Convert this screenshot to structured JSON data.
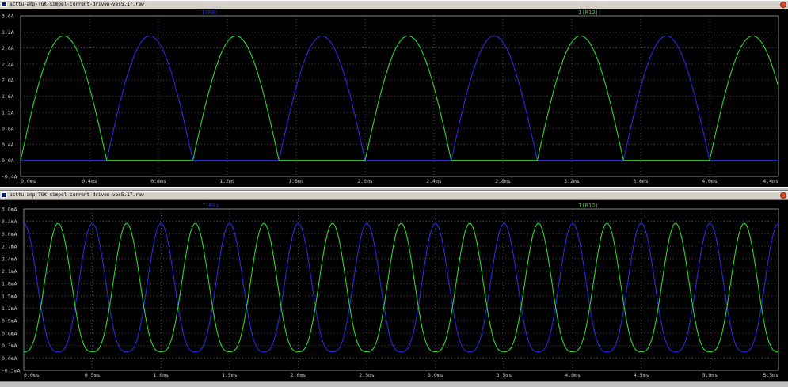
{
  "windows": [
    {
      "title": "acttu-amp-TGK-simpel-current-driven-ves5.17.raw"
    },
    {
      "title": "acttu-amp-TGK-simpel-current-driven-ves5.17.raw"
    }
  ],
  "colors": {
    "background": "#000000",
    "grid": "#7a7a7a",
    "axis": "#a0a0a0",
    "tick_text": "#c8c8c8",
    "series1": "#2a2adf",
    "series2": "#2ad82a"
  },
  "chart_data": [
    {
      "type": "line",
      "xlabel": "",
      "ylabel": "",
      "xlim": [
        0,
        4.4
      ],
      "ylim": [
        -0.4,
        3.6
      ],
      "x_ticks": [
        "0.0ms",
        "0.4ms",
        "0.8ms",
        "1.2ms",
        "1.6ms",
        "2.0ms",
        "2.4ms",
        "2.8ms",
        "3.2ms",
        "3.6ms",
        "4.0ms",
        "4.4ms"
      ],
      "y_ticks": [
        "3.6A",
        "3.2A",
        "2.8A",
        "2.4A",
        "2.0A",
        "1.6A",
        "1.2A",
        "0.8A",
        "0.4A",
        "0.0A",
        "-0.4A"
      ],
      "grid": true,
      "legend_position": "top",
      "waveform": "half-wave rectified sine, period 1 ms, peak 3.1 A",
      "series": [
        {
          "name": "I(R8)",
          "color": "#2a2adf",
          "period_ms": 1.0,
          "phase_ms": 0.5,
          "peak": 3.1,
          "min": 0.0
        },
        {
          "name": "I(R12)",
          "color": "#2ad82a",
          "period_ms": 1.0,
          "phase_ms": 0.0,
          "peak": 3.1,
          "min": 0.0
        }
      ]
    },
    {
      "type": "line",
      "xlabel": "",
      "ylabel": "",
      "xlim": [
        0,
        5.5
      ],
      "ylim": [
        -0.3,
        3.6
      ],
      "x_ticks": [
        "0.0ms",
        "0.5ms",
        "1.0ms",
        "1.5ms",
        "2.0ms",
        "2.5ms",
        "3.0ms",
        "3.5ms",
        "4.0ms",
        "4.5ms",
        "5.0ms",
        "5.5ms"
      ],
      "y_ticks": [
        "3.6mA",
        "3.3mA",
        "3.0mA",
        "2.7mA",
        "2.4mA",
        "2.1mA",
        "1.8mA",
        "1.5mA",
        "1.2mA",
        "0.9mA",
        "0.6mA",
        "0.3mA",
        "0.0mA",
        "-0.3mA"
      ],
      "grid": true,
      "legend_position": "top",
      "waveform": "smooth periodic pulse, period 0.5 ms, peak 3.25 mA, minimum 0.15 mA",
      "series": [
        {
          "name": "I(R8)",
          "color": "#2a2adf",
          "period_ms": 0.5,
          "phase_ms": 0.25,
          "peak": 3.25,
          "min": 0.15
        },
        {
          "name": "I(R12)",
          "color": "#2ad82a",
          "period_ms": 0.5,
          "phase_ms": 0.0,
          "peak": 3.25,
          "min": 0.15
        }
      ]
    }
  ]
}
